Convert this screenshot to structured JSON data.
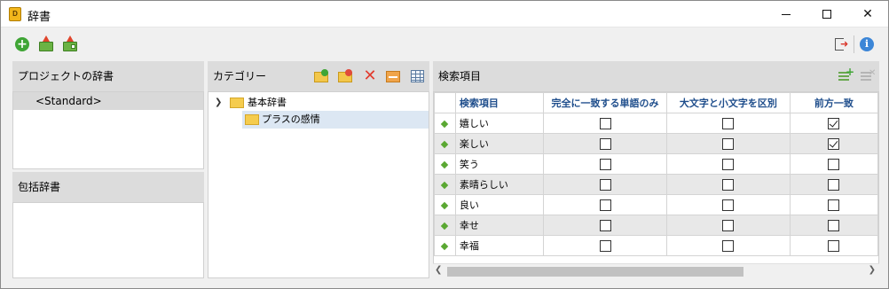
{
  "window": {
    "title": "辞書",
    "app_icon_letter": "D"
  },
  "toolbar": {
    "icons": [
      "add-dictionary-icon",
      "export-icon",
      "import-icon",
      "exit-icon",
      "info-icon"
    ]
  },
  "project_panel": {
    "title": "プロジェクトの辞書",
    "items": [
      {
        "label": "<Standard>",
        "selected": true
      }
    ]
  },
  "inclusive_panel": {
    "title": "包括辞書"
  },
  "category_panel": {
    "title": "カテゴリー",
    "tree": {
      "root": {
        "label": "基本辞書",
        "expanded": true
      },
      "child": {
        "label": "プラスの感情",
        "selected": true
      }
    }
  },
  "search_panel": {
    "title": "検索項目",
    "columns": [
      "検索項目",
      "完全に一致する単語のみ",
      "大文字と小文字を区別",
      "前方一致"
    ],
    "rows": [
      {
        "word": "嬉しい",
        "exact": false,
        "case": false,
        "prefix": true
      },
      {
        "word": "楽しい",
        "exact": false,
        "case": false,
        "prefix": true
      },
      {
        "word": "笑う",
        "exact": false,
        "case": false,
        "prefix": false
      },
      {
        "word": "素晴らしい",
        "exact": false,
        "case": false,
        "prefix": false
      },
      {
        "word": "良い",
        "exact": false,
        "case": false,
        "prefix": false
      },
      {
        "word": "幸せ",
        "exact": false,
        "case": false,
        "prefix": false
      },
      {
        "word": "幸福",
        "exact": false,
        "case": false,
        "prefix": false
      }
    ]
  },
  "colors": {
    "accent_green": "#3fa535",
    "header_text": "#1f4e8c",
    "selection": "#dce7f3"
  }
}
